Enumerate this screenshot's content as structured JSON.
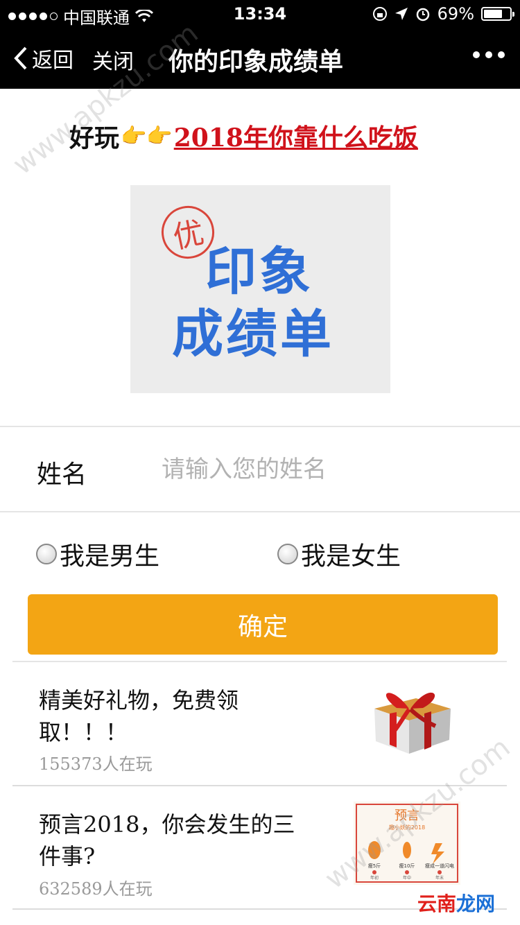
{
  "status_bar": {
    "carrier": "中国联通",
    "time": "13:34",
    "battery_text": "69%",
    "battery_level": 0.69
  },
  "nav": {
    "back_label": "返回",
    "close_label": "关闭",
    "title": "你的印象成绩单"
  },
  "promo": {
    "prefix": "好玩",
    "link_text": "2018年你靠什么吃饭"
  },
  "banner": {
    "seal_text": "优",
    "line1": "印象",
    "line2": "成绩单"
  },
  "form": {
    "name_label": "姓名",
    "name_placeholder": "请输入您的姓名",
    "name_value": "",
    "gender_male": "我是男生",
    "gender_female": "我是女生",
    "confirm_label": "确定"
  },
  "feed": [
    {
      "title": "精美好礼物，免费领取！！！",
      "count": "155373人在玩",
      "thumb": "gift-box"
    },
    {
      "title": "预言2018，你会发生的三件事?",
      "count": "632589人在玩",
      "thumb": "prediction-2018"
    }
  ],
  "thumb_texts": {
    "pred_title": "预言",
    "pred_sub": "趣小妖的2018",
    "pred_items": [
      "瘦5斤",
      "瘦10斤",
      "瘦成一道闪电"
    ],
    "pred_dates": [
      "年初",
      "年中",
      "年末"
    ]
  },
  "watermark": {
    "text": "www.apkzu.com",
    "corner_logo_red": "云南",
    "corner_logo_blue": "龙网"
  },
  "colors": {
    "nav_bg": "#000000",
    "accent": "#f3a514",
    "banner_text": "#2f6fd6",
    "promo_link": "#d0121b"
  }
}
